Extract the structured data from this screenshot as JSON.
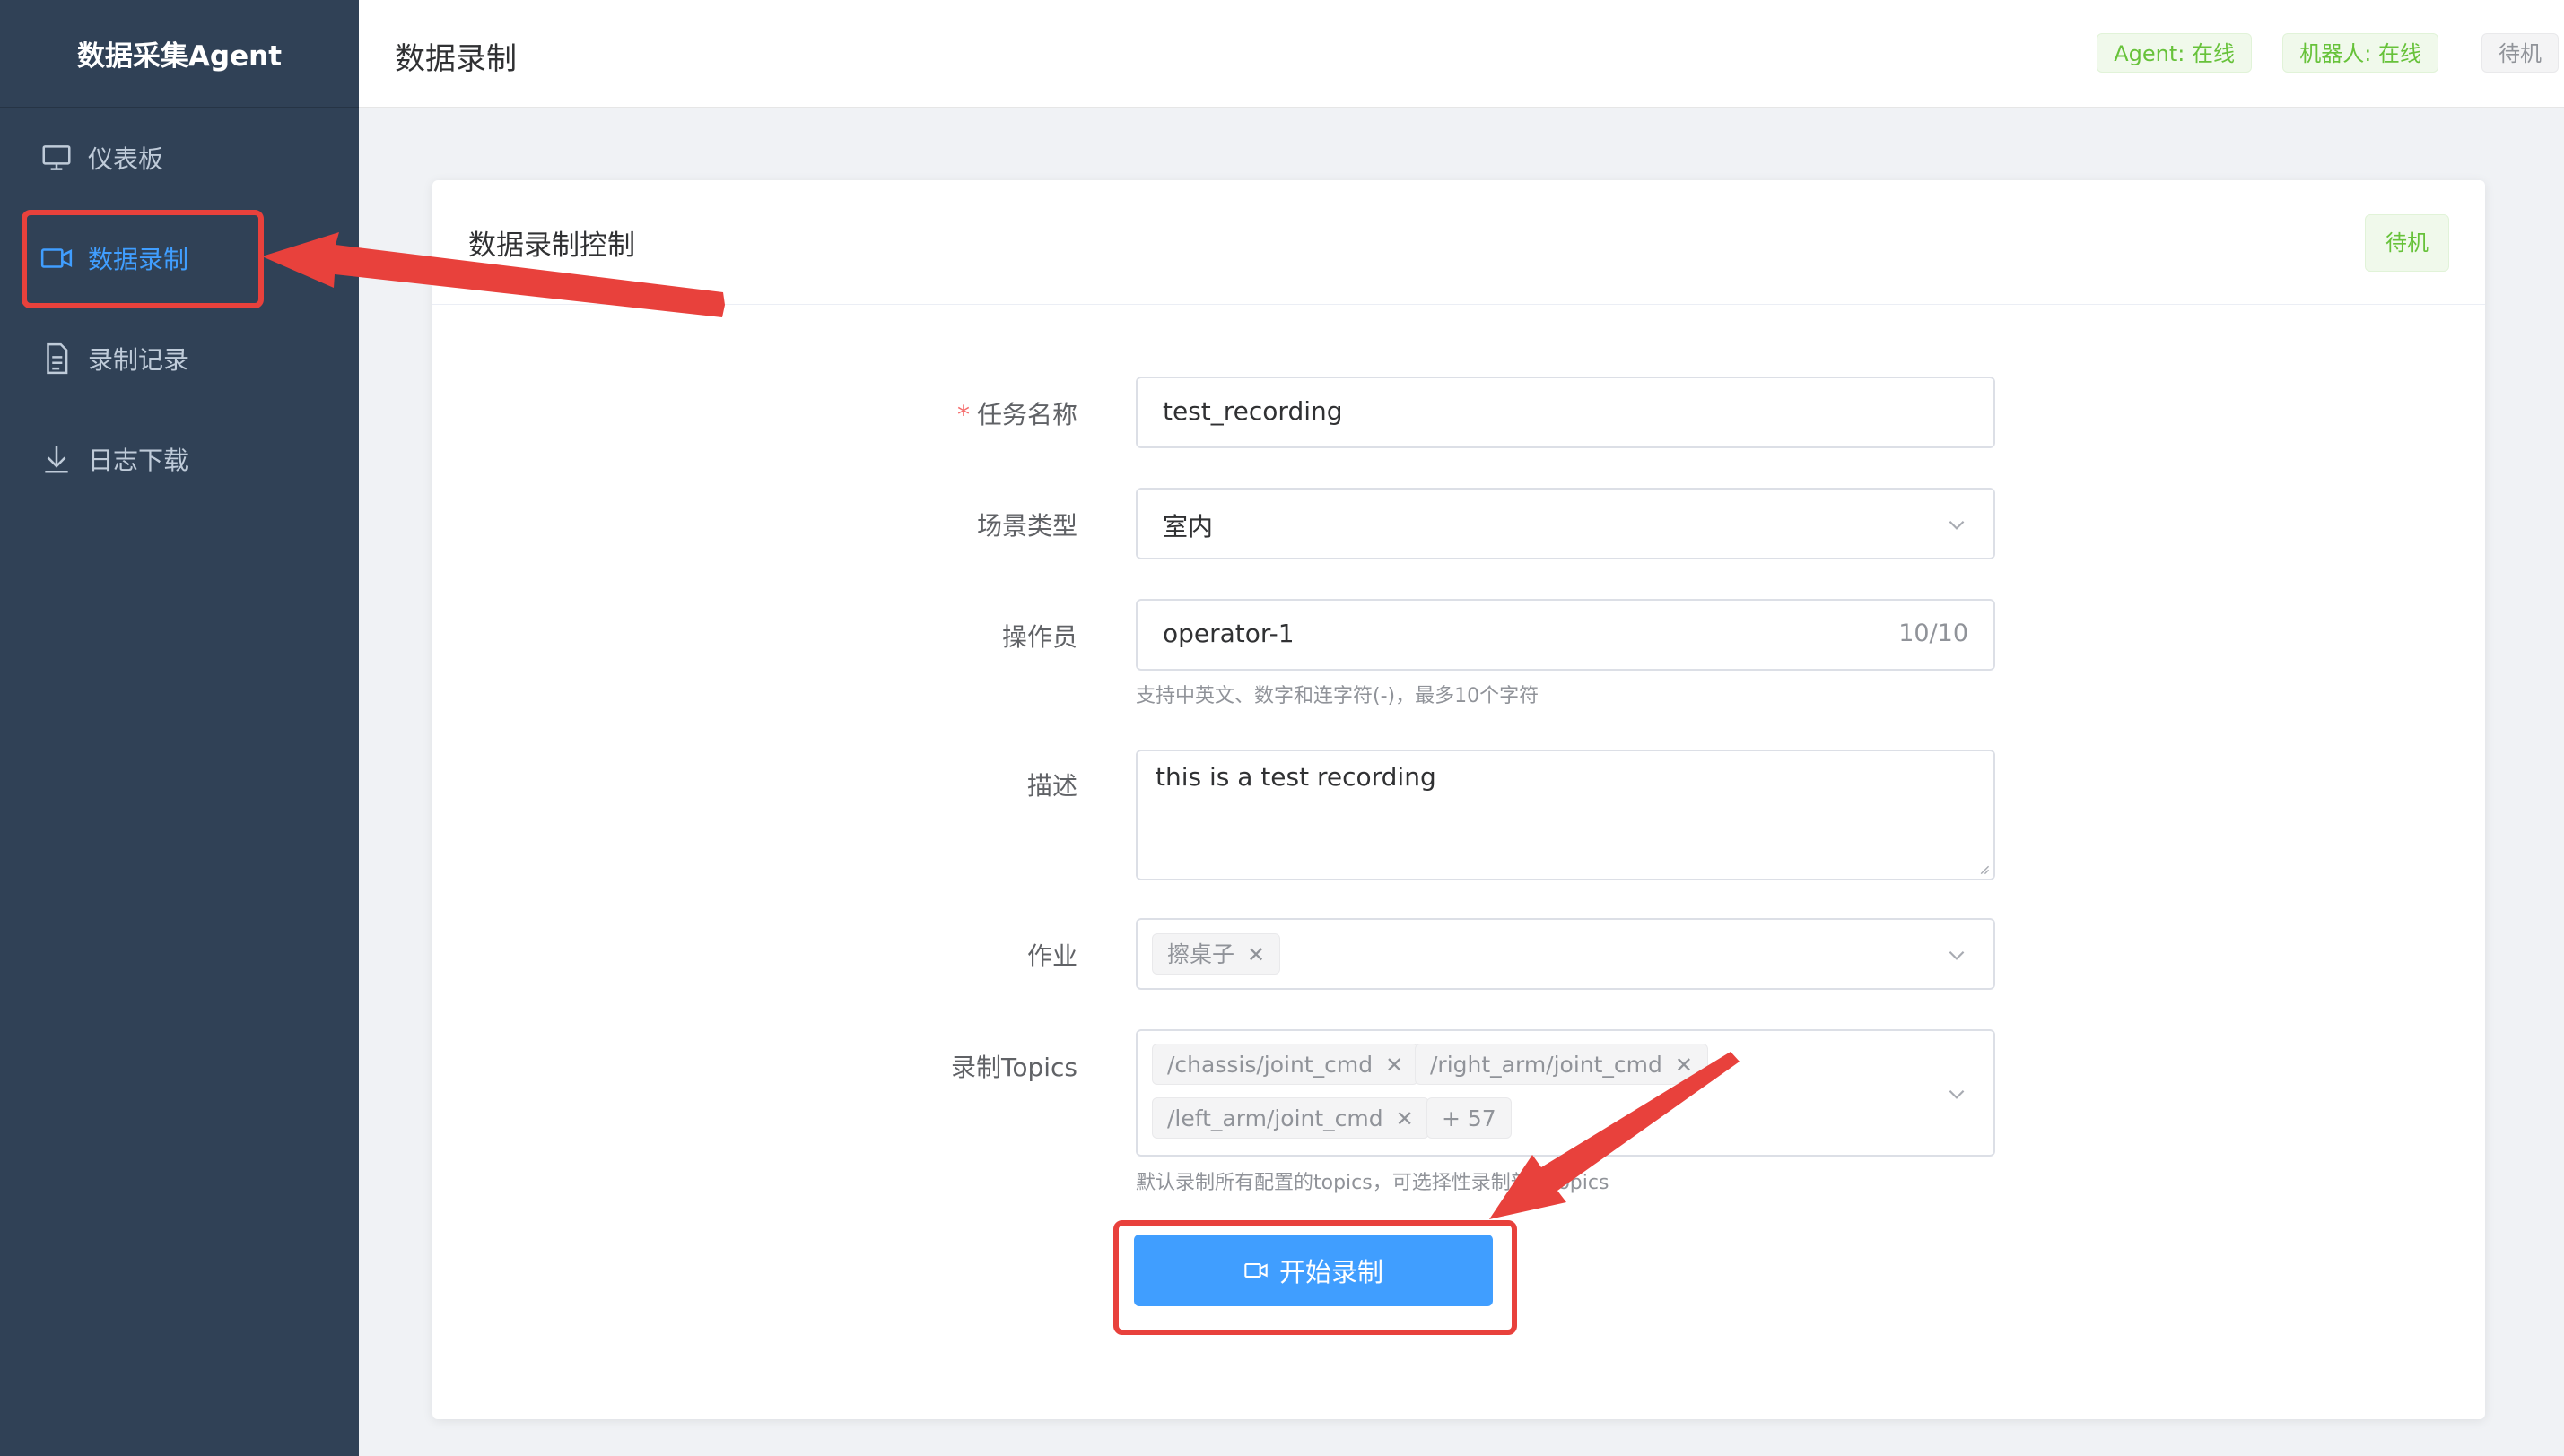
{
  "app": {
    "brand": "数据采集Agent"
  },
  "sidebar": {
    "items": [
      {
        "label": "仪表板",
        "icon": "monitor-icon",
        "active": false
      },
      {
        "label": "数据录制",
        "icon": "video-camera-icon",
        "active": true
      },
      {
        "label": "录制记录",
        "icon": "document-icon",
        "active": false
      },
      {
        "label": "日志下载",
        "icon": "download-icon",
        "active": false
      }
    ]
  },
  "header": {
    "title": "数据录制",
    "badges": [
      {
        "text": "Agent: 在线",
        "status": "success"
      },
      {
        "text": "机器人: 在线",
        "status": "success"
      },
      {
        "text": "待机",
        "status": "info"
      }
    ]
  },
  "card": {
    "title": "数据录制控制",
    "status_badge": "待机"
  },
  "form": {
    "task_name": {
      "label": "任务名称",
      "required": true,
      "value": "test_recording"
    },
    "scene_type": {
      "label": "场景类型",
      "value": "室内"
    },
    "operator": {
      "label": "操作员",
      "value": "operator-1",
      "counter": "10/10",
      "hint": "支持中英文、数字和连字符(-)，最多10个字符"
    },
    "description": {
      "label": "描述",
      "value": "this is a test recording"
    },
    "job": {
      "label": "作业",
      "tags": [
        "擦桌子"
      ]
    },
    "topics": {
      "label": "录制Topics",
      "tags": [
        "/chassis/joint_cmd",
        "/right_arm/joint_cmd",
        "/left_arm/joint_cmd"
      ],
      "more": "+ 57",
      "hint": "默认录制所有配置的topics，可选择性录制部分topics"
    },
    "start_button": {
      "label": "开始录制",
      "icon": "video-camera-icon"
    }
  },
  "colors": {
    "sidebar_bg": "#304156",
    "accent": "#409eff",
    "success": "#67c23a",
    "annotation": "#e8413c"
  }
}
